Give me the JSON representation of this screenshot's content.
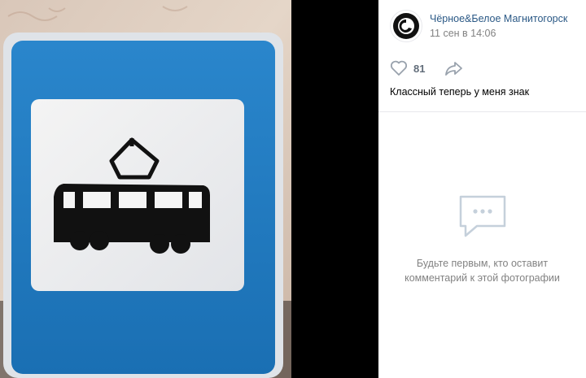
{
  "post": {
    "author": "Чёрное&Белое Магнитогорск",
    "date": "11 сен в 14:06",
    "likes": "81",
    "caption": "Классный теперь у меня знак"
  },
  "comments": {
    "empty_line1": "Будьте первым, кто оставит",
    "empty_line2": "комментарий к этой фотографии"
  },
  "icons": {
    "like": "heart-icon",
    "share": "share-arrow-icon",
    "comments": "speech-bubble-icon"
  },
  "colors": {
    "link": "#2a5885",
    "muted": "#828282",
    "sign_blue": "#1f7cc2"
  }
}
